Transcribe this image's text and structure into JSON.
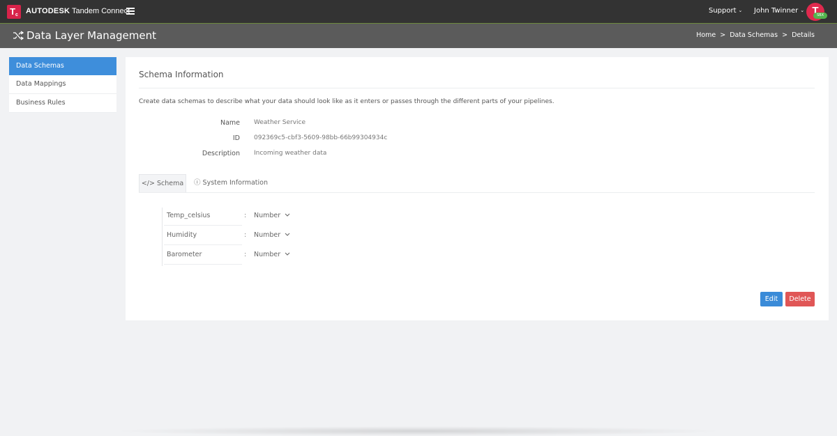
{
  "app": {
    "logo_text": "T",
    "logo_sub": "c",
    "brand_bold": "AUTODESK",
    "brand_rest": "Tandem Connect",
    "support_label": "Support",
    "user_name": "John Twinner",
    "avatar_letter": "T",
    "avatar_badge": "SBX"
  },
  "header": {
    "page_title": "Data Layer Management",
    "breadcrumb": [
      "Home",
      "Data Schemas",
      "Details"
    ],
    "breadcrumb_sep": ">"
  },
  "sidebar": {
    "items": [
      {
        "label": "Data Schemas",
        "active": true
      },
      {
        "label": "Data Mappings",
        "active": false
      },
      {
        "label": "Business Rules",
        "active": false
      }
    ]
  },
  "schema_info": {
    "title": "Schema Information",
    "description": "Create data schemas to describe what your data should look like as it enters or passes through the different parts of your pipelines.",
    "fields": [
      {
        "label": "Name",
        "value": "Weather Service"
      },
      {
        "label": "ID",
        "value": "092369c5-cbf3-5609-98bb-66b99304934c"
      },
      {
        "label": "Description",
        "value": "Incoming weather data"
      }
    ]
  },
  "tabs": [
    {
      "label": "Schema",
      "icon": "code-icon",
      "active": true
    },
    {
      "label": "System Information",
      "icon": "info-icon",
      "active": false
    }
  ],
  "schema_fields": [
    {
      "name": "Temp_celsius",
      "separator": ":",
      "type": "Number"
    },
    {
      "name": "Humidity",
      "separator": ":",
      "type": "Number"
    },
    {
      "name": "Barometer",
      "separator": ":",
      "type": "Number"
    }
  ],
  "actions": {
    "edit_label": "Edit",
    "delete_label": "Delete"
  },
  "colors": {
    "topbar": "#333333",
    "titleband": "#5b5b5b",
    "accent": "#3e8edb",
    "danger": "#e05656",
    "brand_red": "#d8234a",
    "badge_green": "#52b44d"
  }
}
